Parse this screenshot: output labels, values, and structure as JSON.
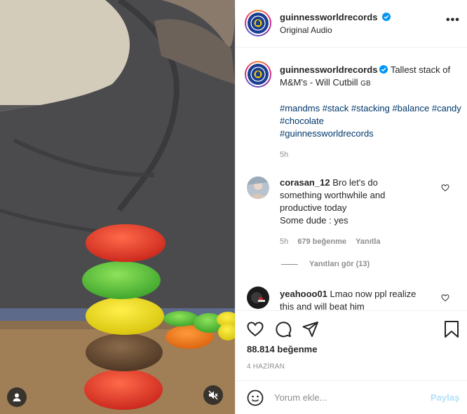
{
  "post": {
    "username": "guinnessworldrecords",
    "audio": "Original Audio",
    "more_icon": "more-dots-icon"
  },
  "caption": {
    "text": "Tallest stack of M&M's - Will Cutbill",
    "country": "GB",
    "hashtags": [
      "#mandms",
      "#stack",
      "#stacking",
      "#balance",
      "#candy",
      "#chocolate",
      "#guinnessworldrecords"
    ],
    "time": "5h"
  },
  "comments": [
    {
      "username": "corasan_12",
      "text": "Bro let's do something worthwhile and productive today",
      "text2": "Some dude : yes",
      "time": "5h",
      "likes": "679 beğenme",
      "reply": "Yanıtla",
      "view_replies": "Yanıtları gör (13)"
    },
    {
      "username": "yeahooo01",
      "text": "Lmao now ppl realize this and will beat him"
    }
  ],
  "actions": {
    "likes": "88.814 beğenme",
    "date": "4 HAZİRAN"
  },
  "comment_box": {
    "placeholder": "Yorum ekle...",
    "share_label": "Paylaş"
  },
  "colors": {
    "link": "#00376b",
    "verified": "#0095f6",
    "share_disabled": "#b2dffc"
  }
}
